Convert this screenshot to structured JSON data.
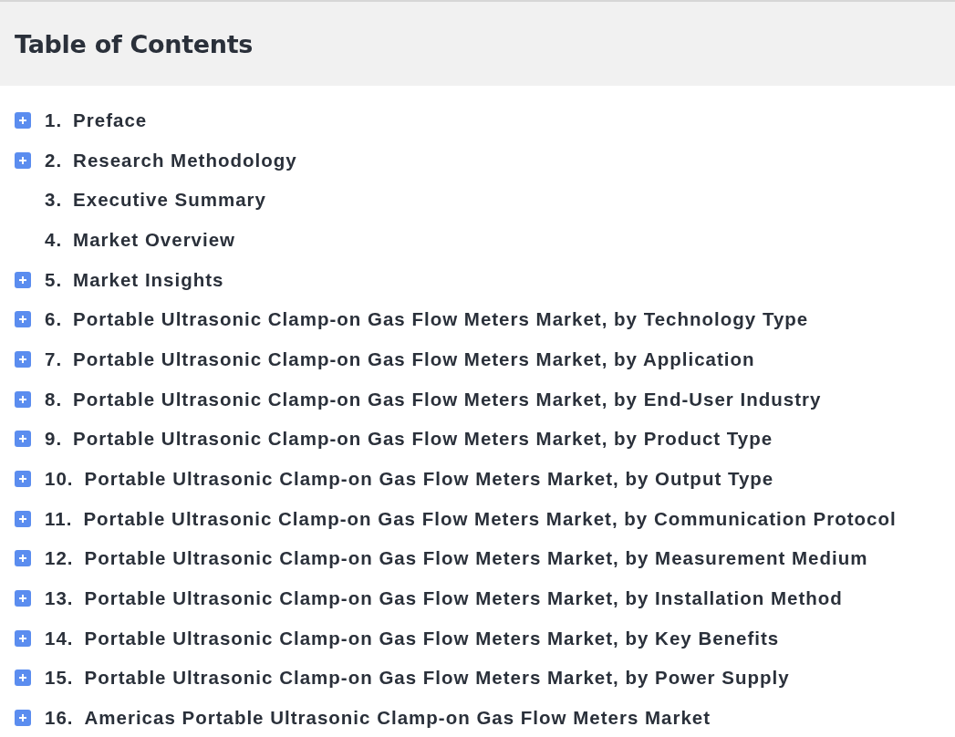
{
  "header": {
    "title": "Table of Contents"
  },
  "items": [
    {
      "number": "1.",
      "title": "Preface",
      "expandable": true
    },
    {
      "number": "2.",
      "title": "Research Methodology",
      "expandable": true
    },
    {
      "number": "3.",
      "title": "Executive Summary",
      "expandable": false
    },
    {
      "number": "4.",
      "title": "Market Overview",
      "expandable": false
    },
    {
      "number": "5.",
      "title": "Market Insights",
      "expandable": true
    },
    {
      "number": "6.",
      "title": "Portable Ultrasonic Clamp-on Gas Flow Meters Market, by Technology Type",
      "expandable": true
    },
    {
      "number": "7.",
      "title": "Portable Ultrasonic Clamp-on Gas Flow Meters Market, by Application",
      "expandable": true
    },
    {
      "number": "8.",
      "title": "Portable Ultrasonic Clamp-on Gas Flow Meters Market, by End-User Industry",
      "expandable": true
    },
    {
      "number": "9.",
      "title": "Portable Ultrasonic Clamp-on Gas Flow Meters Market, by Product Type",
      "expandable": true
    },
    {
      "number": "10.",
      "title": "Portable Ultrasonic Clamp-on Gas Flow Meters Market, by Output Type",
      "expandable": true
    },
    {
      "number": "11.",
      "title": "Portable Ultrasonic Clamp-on Gas Flow Meters Market, by Communication Protocol",
      "expandable": true
    },
    {
      "number": "12.",
      "title": "Portable Ultrasonic Clamp-on Gas Flow Meters Market, by Measurement Medium",
      "expandable": true
    },
    {
      "number": "13.",
      "title": "Portable Ultrasonic Clamp-on Gas Flow Meters Market, by Installation Method",
      "expandable": true
    },
    {
      "number": "14.",
      "title": "Portable Ultrasonic Clamp-on Gas Flow Meters Market, by Key Benefits",
      "expandable": true
    },
    {
      "number": "15.",
      "title": "Portable Ultrasonic Clamp-on Gas Flow Meters Market, by Power Supply",
      "expandable": true
    },
    {
      "number": "16.",
      "title": "Americas Portable Ultrasonic Clamp-on Gas Flow Meters Market",
      "expandable": true
    }
  ]
}
